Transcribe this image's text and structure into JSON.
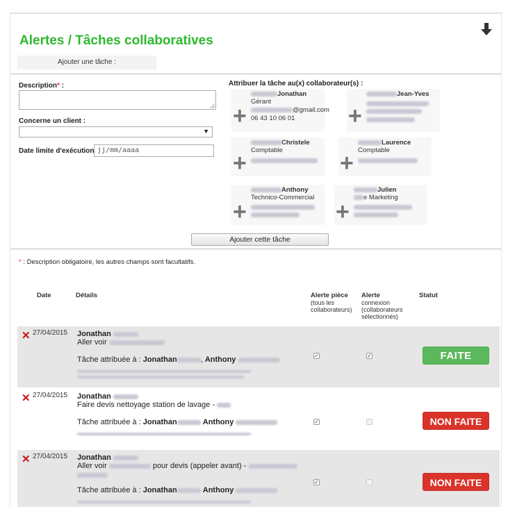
{
  "page": {
    "title": "Alertes / Tâches collaboratives",
    "tab_add_task": "Ajouter une tâche :"
  },
  "form": {
    "description_label": "Description",
    "required_mark": "*",
    "description_colon": " :",
    "client_label": "Concerne un client :",
    "date_label": "Date limite d'exécution :",
    "date_placeholder": "jj/mm/aaaa",
    "assign_label": "Attribuer la tâche au(x) collaborateur(s) :",
    "submit_label": "Ajouter cette tâche",
    "footnote_mark": "*",
    "footnote_text": " : Description obligatoire, les autres champs sont facultatifs."
  },
  "collaborators": [
    {
      "name": "Jonathan",
      "role": "Gérant",
      "email_suffix": "@gmail.com",
      "phone": "06 43 10 06 01"
    },
    {
      "name": "Jean-Yves",
      "role": "",
      "email_suffix": "",
      "phone": ""
    },
    {
      "name": "Christele",
      "role": "Comptable",
      "email_suffix": "",
      "phone": ""
    },
    {
      "name": "Laurence",
      "role": "Comptable",
      "email_suffix": "",
      "phone": ""
    },
    {
      "name": "Anthony",
      "role": "Technico-Commercial",
      "email_suffix": "",
      "phone": ""
    },
    {
      "name": "Julien",
      "role": "e Marketing",
      "email_suffix": "",
      "phone": ""
    }
  ],
  "table": {
    "headers": {
      "date": "Date",
      "details": "Détails",
      "alert_piece": "Alerte pièce",
      "alert_piece_sub1": "(tous les",
      "alert_piece_sub2": "collaborateurs)",
      "alert_conn": "Alerte",
      "alert_conn_sub1": "connexion",
      "alert_conn_sub2": "(collaborateurs",
      "alert_conn_sub3": "sélectionnés)",
      "status": "Statut"
    },
    "rows": [
      {
        "date": "27/04/2015",
        "author": "Jonathan",
        "text": "Aller voir",
        "assigned_prefix": "Tâche attribuée à :",
        "assigned_1": "Jonathan",
        "assigned_sep": ",",
        "assigned_2": "Anthony",
        "status": "FAITE",
        "alert_piece": true,
        "alert_conn": true
      },
      {
        "date": "27/04/2015",
        "author": "Jonathan",
        "text": "Faire devis nettoyage station de lavage -",
        "assigned_prefix": "Tâche attribuée à :",
        "assigned_1": "Jonathan",
        "assigned_2": "Anthony",
        "status": "NON FAITE",
        "alert_piece": true,
        "alert_conn": false
      },
      {
        "date": "27/04/2015",
        "author": "Jonathan",
        "text_a": "Aller voir",
        "text_b": "pour devis (appeler avant) -",
        "assigned_prefix": "Tâche attribuée à :",
        "assigned_1": "Jonathan",
        "assigned_2": "Anthony",
        "status": "NON FAITE",
        "alert_piece": true,
        "alert_conn": false
      }
    ]
  },
  "colors": {
    "title_green": "#2eb82e",
    "done_green": "#5cb85c",
    "todo_red": "#d9332a",
    "delete_red": "#cc1111"
  }
}
